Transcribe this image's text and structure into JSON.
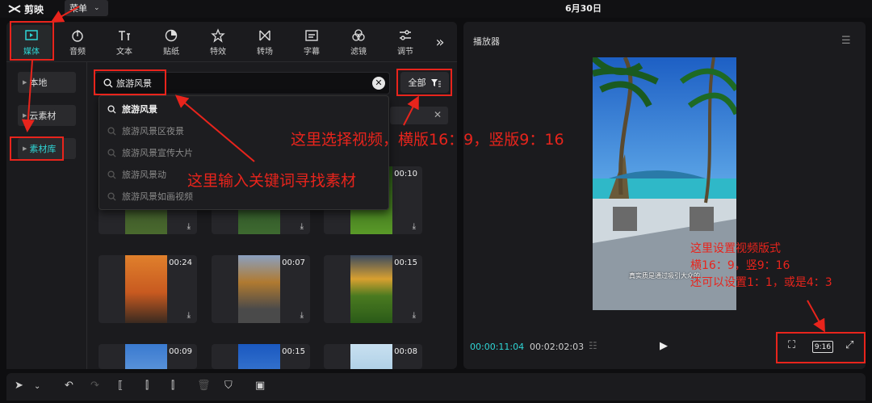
{
  "app": {
    "name": "剪映",
    "menu_label": "菜单",
    "project_title": "6月30日"
  },
  "toolbar": {
    "tools": [
      {
        "label": "媒体",
        "icon": "media-icon",
        "active": true
      },
      {
        "label": "音频",
        "icon": "audio-icon"
      },
      {
        "label": "文本",
        "icon": "text-icon"
      },
      {
        "label": "贴纸",
        "icon": "sticker-icon"
      },
      {
        "label": "特效",
        "icon": "effects-icon"
      },
      {
        "label": "转场",
        "icon": "transition-icon"
      },
      {
        "label": "字幕",
        "icon": "subtitle-icon"
      },
      {
        "label": "滤镜",
        "icon": "filter-icon"
      },
      {
        "label": "调节",
        "icon": "adjust-icon"
      }
    ],
    "more_icon": "double-chevron-right-icon"
  },
  "sidebar": {
    "items": [
      {
        "label": "本地"
      },
      {
        "label": "云素材"
      },
      {
        "label": "素材库",
        "active": true
      }
    ]
  },
  "search": {
    "value": "旅游风景",
    "filter_label": "全部",
    "suggestions": [
      "旅游风景",
      "旅游风景区夜景",
      "旅游风景宣传大片",
      "旅游风景动",
      "旅游风景如画视频"
    ]
  },
  "media_grid": {
    "items": [
      {
        "duration": "",
        "color": "#3d5a2a"
      },
      {
        "duration": "",
        "color": "#2e5a2e"
      },
      {
        "duration": "00:10",
        "color": "#3f7a20"
      },
      {
        "duration": "00:24",
        "color": "#c9722c"
      },
      {
        "duration": "00:07",
        "color": "#7a6a4a"
      },
      {
        "duration": "00:15",
        "color": "#8a8a30"
      },
      {
        "duration": "00:09",
        "color": "#4a86c8"
      },
      {
        "duration": "00:15",
        "color": "#2a66c0"
      },
      {
        "duration": "00:08",
        "color": "#a8c8e0"
      }
    ]
  },
  "player": {
    "title": "播放器",
    "caption": "真实质是通过吸引大众的",
    "current_time": "00:00:11:04",
    "total_time": "00:02:02:03",
    "ratio_label": "9:16"
  },
  "annotations": {
    "keyword_tip": "这里输入关键词寻找素材",
    "filter_tip": "这里选择视频，横版16：9，竖版9：16",
    "ratio_tip_lines": [
      "这里设置视频版式",
      "横16：9，竖9：16",
      "还可以设置1：1，或是4：3"
    ],
    "color": "#e8241c"
  }
}
